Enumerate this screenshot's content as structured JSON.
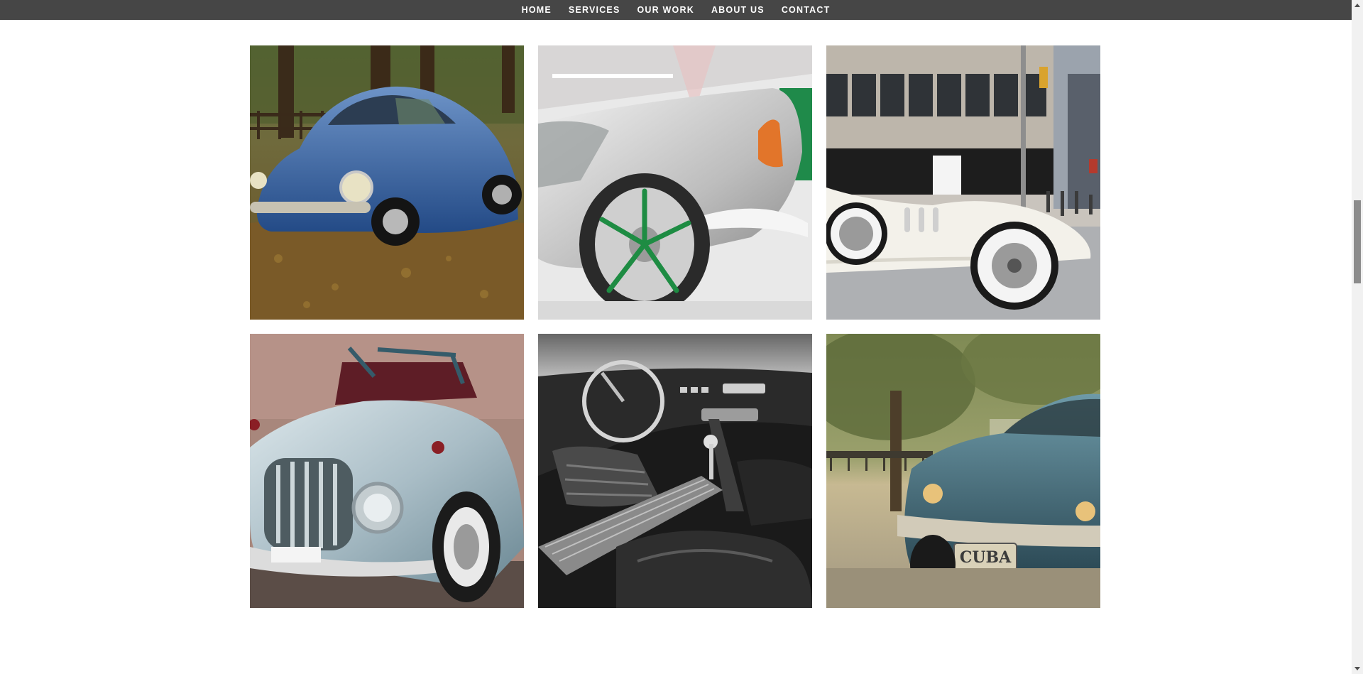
{
  "nav": {
    "items": [
      {
        "label": "HOME"
      },
      {
        "label": "SERVICES"
      },
      {
        "label": "OUR WORK"
      },
      {
        "label": "ABOUT US"
      },
      {
        "label": "CONTACT"
      }
    ]
  },
  "gallery": {
    "items": [
      {
        "subject": "blue vintage beetle on autumn leaves"
      },
      {
        "subject": "silver lowrider with green rims"
      },
      {
        "subject": "white classic roadster on city street"
      },
      {
        "subject": "light blue vintage convertible"
      },
      {
        "subject": "black and white classic car interior"
      },
      {
        "subject": "teal classic car",
        "plate_text": "CUBA"
      }
    ]
  },
  "colors": {
    "navbar_bg": "#464646",
    "nav_text": "#ffffff",
    "page_bg": "#ffffff"
  }
}
